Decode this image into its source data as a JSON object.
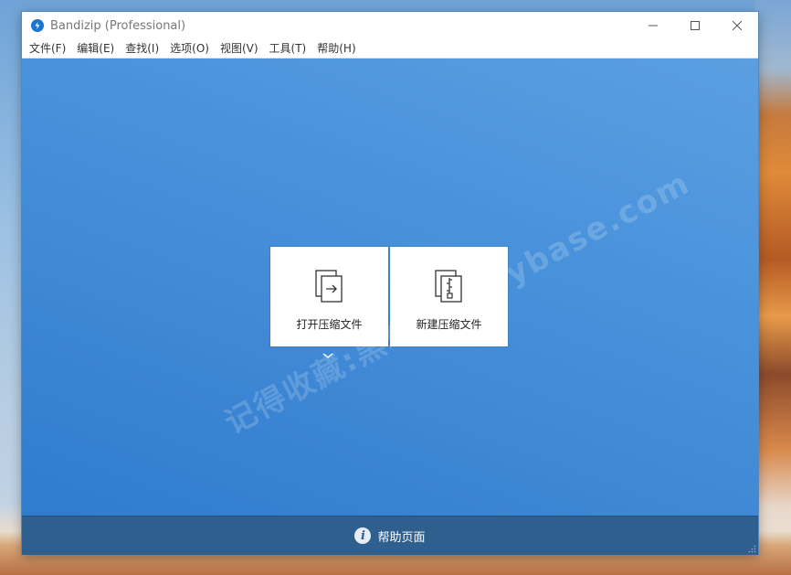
{
  "window": {
    "title": "Bandizip (Professional)",
    "icon": "bandizip-logo-icon"
  },
  "menu": {
    "items": [
      {
        "label": "文件(F)"
      },
      {
        "label": "编辑(E)"
      },
      {
        "label": "查找(I)"
      },
      {
        "label": "选项(O)"
      },
      {
        "label": "视图(V)"
      },
      {
        "label": "工具(T)"
      },
      {
        "label": "帮助(H)"
      }
    ]
  },
  "main": {
    "open_archive_label": "打开压缩文件",
    "new_archive_label": "新建压缩文件",
    "watermark": "记得收藏:黑域基地 Hybase.com"
  },
  "footer": {
    "help_label": "帮助页面"
  },
  "colors": {
    "content_bg": "#3c86d4",
    "footer_bg": "#2f5f8f",
    "accent": "#1a74d1"
  }
}
